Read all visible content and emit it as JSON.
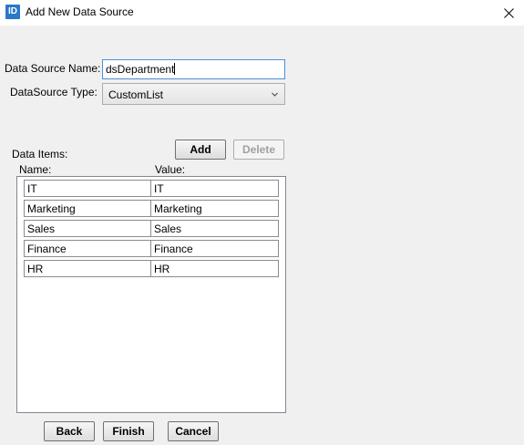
{
  "window": {
    "icon_text": "ID",
    "title": "Add New Data Source",
    "close_icon": "close-icon"
  },
  "form": {
    "name_label": "Data Source Name:",
    "name_value": "dsDepartment",
    "type_label": "DataSource Type:",
    "type_value": "CustomList",
    "items_label": "Data Items:",
    "add_label": "Add",
    "delete_label": "Delete",
    "col_name": "Name:",
    "col_value": "Value:",
    "rows": [
      {
        "name": "IT",
        "value": "IT"
      },
      {
        "name": "Marketing",
        "value": "Marketing"
      },
      {
        "name": "Sales",
        "value": "Sales"
      },
      {
        "name": "Finance",
        "value": "Finance"
      },
      {
        "name": "HR",
        "value": "HR"
      }
    ]
  },
  "footer": {
    "back_label": "Back",
    "finish_label": "Finish",
    "cancel_label": "Cancel"
  },
  "colors": {
    "accent": "#2b78c5",
    "focus_border": "#4a90d9"
  }
}
